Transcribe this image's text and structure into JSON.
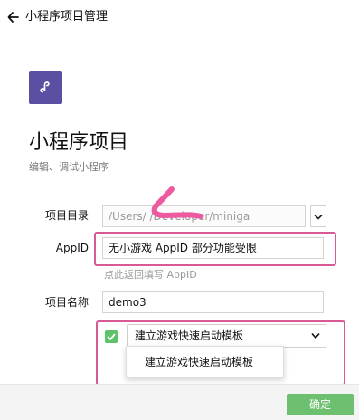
{
  "header": {
    "back_label": "小程序项目管理"
  },
  "project": {
    "title": "小程序项目",
    "subtitle": "编辑、调试小程序",
    "logo_color": "#5b4fa3"
  },
  "fields": {
    "directory": {
      "label": "项目目录",
      "value": "/Users/           /Developer/miniga"
    },
    "appid": {
      "label": "AppID",
      "value": "无小游戏 AppID 部分功能受限",
      "hint": "点此返回填写 AppID"
    },
    "name": {
      "label": "项目名称",
      "value": "demo3"
    }
  },
  "template": {
    "checked": true,
    "selected": "建立游戏快速启动模板",
    "options": [
      "建立游戏快速启动模板"
    ]
  },
  "footer": {
    "confirm_label": "确定"
  },
  "colors": {
    "highlight": "#d85a94",
    "confirm": "#6cc06f",
    "checkbox": "#5ec26a"
  }
}
